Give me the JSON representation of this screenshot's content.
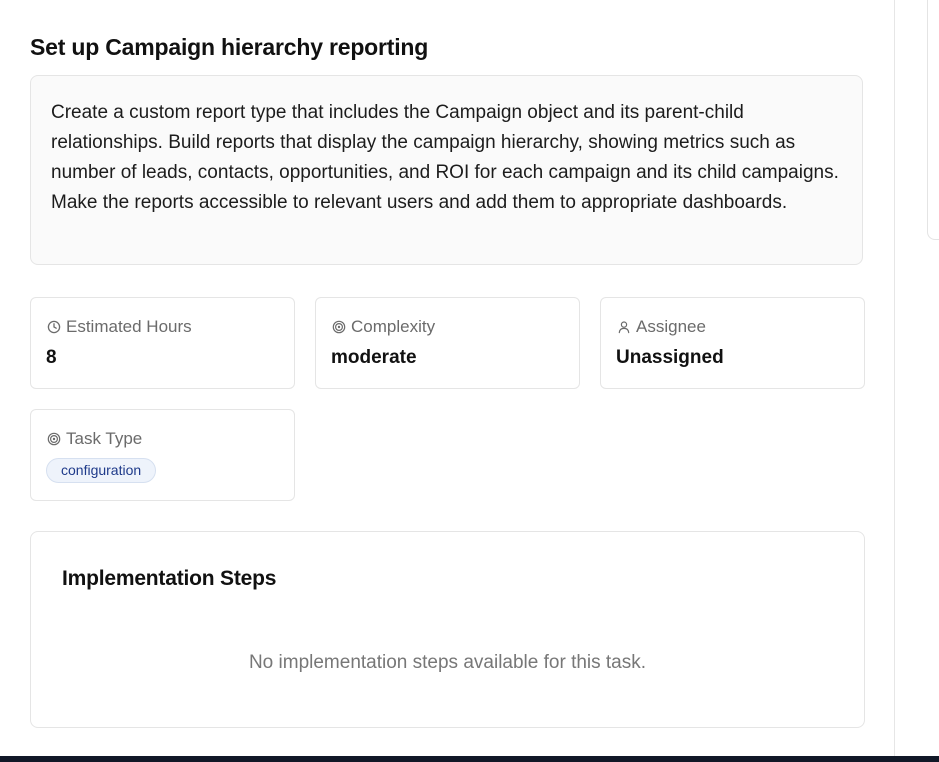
{
  "task": {
    "title": "Set up Campaign hierarchy reporting",
    "description": "Create a custom report type that includes the Campaign object and its parent-child relationships. Build reports that display the campaign hierarchy, showing metrics such as number of leads, contacts, opportunities, and ROI for each campaign and its child campaigns. Make the reports accessible to relevant users and add them to appropriate dashboards."
  },
  "meta": {
    "estimated_hours": {
      "label": "Estimated Hours",
      "value": "8",
      "icon": "clock-icon"
    },
    "complexity": {
      "label": "Complexity",
      "value": "moderate",
      "icon": "target-icon"
    },
    "assignee": {
      "label": "Assignee",
      "value": "Unassigned",
      "icon": "user-icon"
    },
    "task_type": {
      "label": "Task Type",
      "value": "configuration",
      "icon": "target-icon"
    }
  },
  "implementation_steps": {
    "heading": "Implementation Steps",
    "empty_message": "No implementation steps available for this task."
  },
  "colors": {
    "text_primary": "#111111",
    "text_muted": "#6b6b6b",
    "badge_text": "#1e3a8a",
    "badge_bg": "#eef3fb",
    "bottom_bar": "#111827"
  }
}
